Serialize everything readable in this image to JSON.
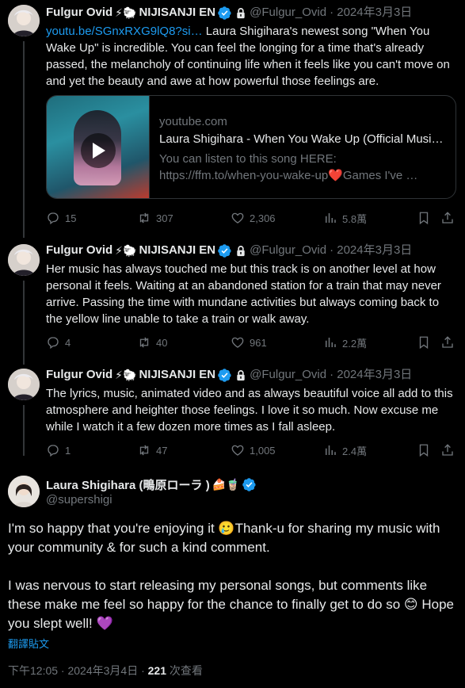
{
  "author": {
    "name": "Fulgur Ovid",
    "emoji": "⚡🐑",
    "suffix": "NIJISANJI EN",
    "handle": "@Fulgur_Ovid",
    "date": "· 2024年3月3日"
  },
  "tweets": [
    {
      "link": "youtu.be/SGnxRXG9lQ8?si…",
      "text": "Laura Shigihara's newest song \"When You Wake Up\" is incredible. You can feel the longing for a time that's already passed, the melancholy of continuing life when it feels like you can't move on and yet the beauty and awe at how powerful those feelings are.",
      "card": {
        "domain": "youtube.com",
        "title": "Laura Shigihara - When You Wake Up (Official Musi…",
        "desc_1": "You can listen to this song HERE:",
        "desc_2": "https://ffm.to/when-you-wake-up",
        "desc_heart": "❤️",
        "desc_3": "Games I've …"
      },
      "replies": "15",
      "reposts": "307",
      "likes": "2,306",
      "views": "5.8萬"
    },
    {
      "text": "Her music has always touched me but this track is on another level at how personal it feels. Waiting at an abandoned station for a train that may never arrive. Passing the time with mundane activities but always coming back to the yellow line unable to take a train or walk away.",
      "replies": "4",
      "reposts": "40",
      "likes": "961",
      "views": "2.2萬"
    },
    {
      "text": "The lyrics, music, animated video and as always beautiful voice all add to this atmosphere and heighter those feelings. I love it so much. Now excuse me while I watch it a few dozen more times as I fall asleep.",
      "replies": "1",
      "reposts": "47",
      "likes": "1,005",
      "views": "2.4萬"
    }
  ],
  "main": {
    "name": "Laura Shigihara (鴫原ローラ )",
    "emoji": "🍰🧋",
    "handle": "@supershigi",
    "line_1a": "I'm so happy that you're enjoying it ",
    "emoji_1": "🥲",
    "line_1b": "Thank-u for sharing my music with your community & for such a kind comment.",
    "line_2a": "I was nervous to start releasing my personal songs, but comments like these make me feel so happy for the chance to finally get to do so ",
    "emoji_2": "😊",
    "line_2b": " Hope you slept well! ",
    "emoji_3": "💜",
    "translate": "翻譯貼文",
    "time": "下午12:05 · 2024年3月4日 · ",
    "views": "221",
    "views_label": " 次查看"
  },
  "colors": {
    "accent": "#1d9bf0",
    "muted": "#71767b",
    "text": "#e7e9ea",
    "bg": "#000000",
    "verified": "#1d9bf0"
  }
}
